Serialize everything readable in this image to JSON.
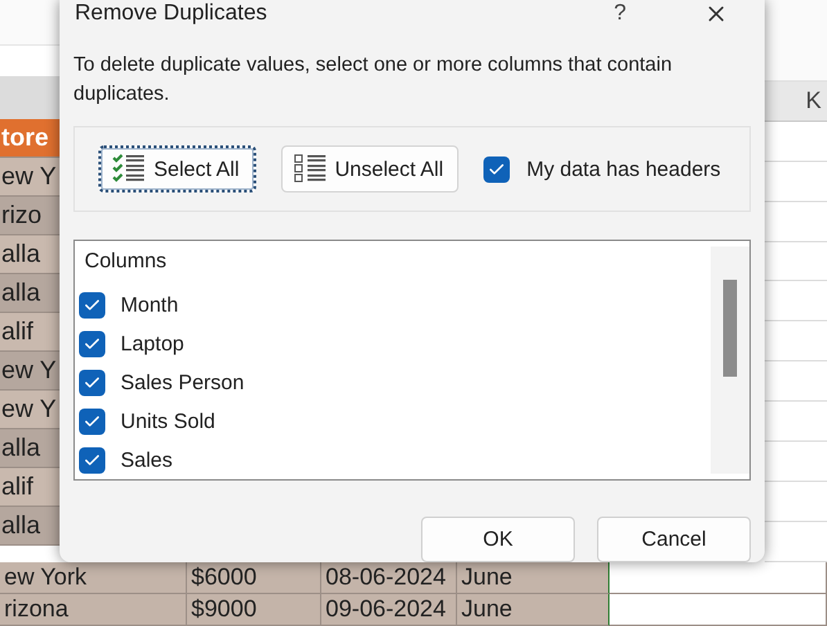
{
  "spreadsheet": {
    "column_header": "K",
    "left_cells": [
      {
        "text": "tore",
        "kind": "header"
      },
      {
        "text": "ew Y",
        "kind": "cell"
      },
      {
        "text": "rizo",
        "kind": "cell"
      },
      {
        "text": "alla",
        "kind": "cell"
      },
      {
        "text": "alla",
        "kind": "cell"
      },
      {
        "text": "alif",
        "kind": "cell"
      },
      {
        "text": "ew Y",
        "kind": "cell"
      },
      {
        "text": "ew Y",
        "kind": "cell"
      },
      {
        "text": "alla",
        "kind": "cell"
      },
      {
        "text": "alif",
        "kind": "cell"
      },
      {
        "text": "alla",
        "kind": "cell"
      }
    ],
    "bottom_rows": [
      [
        "ew York",
        "$6000",
        "08-06-2024",
        "June"
      ],
      [
        "rizona",
        "$9000",
        "09-06-2024",
        "June"
      ]
    ]
  },
  "dialog": {
    "title": "Remove Duplicates",
    "help": "?",
    "instructions": "To delete duplicate values, select one or more columns that contain duplicates.",
    "select_all": "Select All",
    "unselect_all": "Unselect All",
    "headers_checkbox": {
      "label": "My data has headers",
      "checked": true
    },
    "columns_heading": "Columns",
    "columns": [
      {
        "label": "Month",
        "checked": true
      },
      {
        "label": "Laptop",
        "checked": true
      },
      {
        "label": "Sales Person",
        "checked": true
      },
      {
        "label": "Units Sold",
        "checked": true
      },
      {
        "label": "Sales",
        "checked": true
      }
    ],
    "buttons": [
      "OK",
      "Cancel"
    ]
  }
}
